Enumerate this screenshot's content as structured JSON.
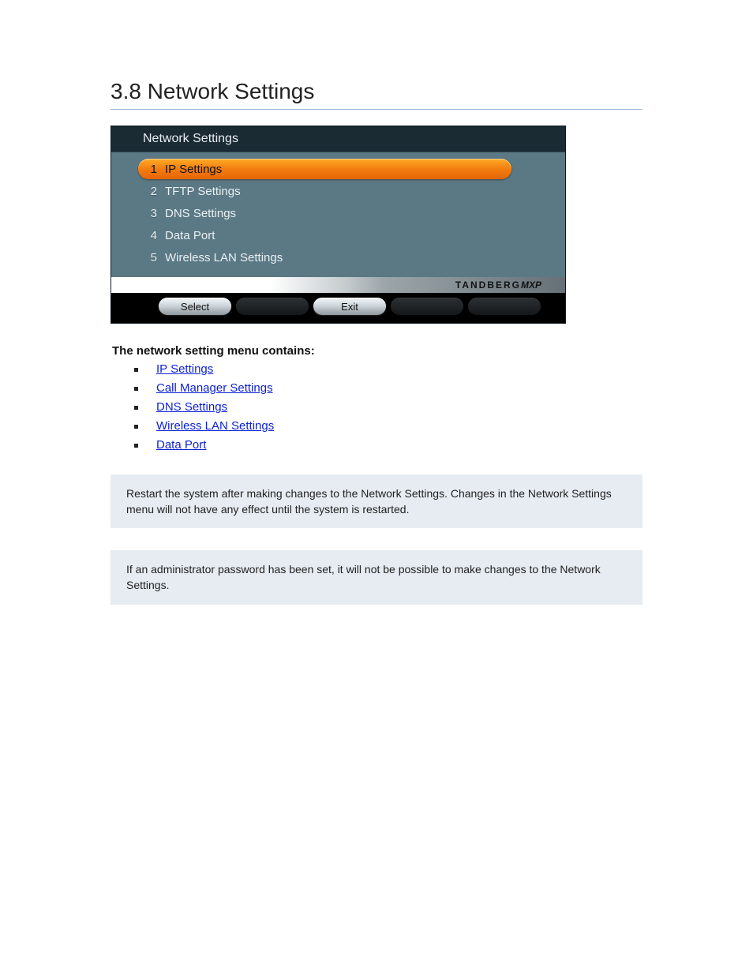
{
  "section_title": "3.8 Network Settings",
  "menu": {
    "title": "Network Settings",
    "items": [
      {
        "num": "1",
        "label": "IP Settings",
        "selected": true
      },
      {
        "num": "2",
        "label": "TFTP Settings",
        "selected": false
      },
      {
        "num": "3",
        "label": "DNS Settings",
        "selected": false
      },
      {
        "num": "4",
        "label": "Data Port",
        "selected": false
      },
      {
        "num": "5",
        "label": "Wireless LAN Settings",
        "selected": false
      }
    ],
    "brand_main": "TANDBERG",
    "brand_suffix": "MXP",
    "buttons": {
      "select": "Select",
      "exit": "Exit"
    }
  },
  "lead_text": "The network setting menu contains:",
  "refs": [
    "IP Settings",
    "Call Manager Settings",
    "DNS Settings",
    "Wireless LAN Settings",
    "Data Port"
  ],
  "info1": "Restart the system after making changes to the Network Settings. Changes in the Network Settings menu will not have any effect until the system is restarted.",
  "info2": "If an administrator password has been set, it will not be possible to make changes to the Network Settings."
}
